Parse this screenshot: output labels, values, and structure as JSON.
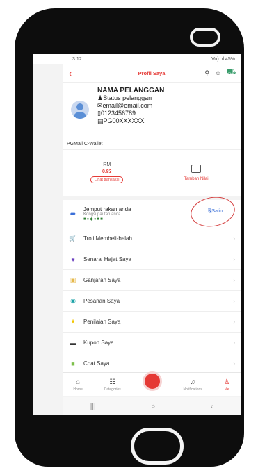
{
  "status": {
    "time": "3:12",
    "signal": "Vo) .ıl 45%"
  },
  "appbar": {
    "title": "Profil Saya"
  },
  "profile": {
    "name": "NAMA PELANGGAN",
    "status": "Status pelanggan",
    "email": "email@email.com",
    "phone": "0123456789",
    "id": "PG00XXXXXX"
  },
  "wallet": {
    "title": "PGMall C-Wallet",
    "currency": "RM",
    "amount": "0.83",
    "history_label": "Lihat transaksi",
    "topup_label": "Tambah Nilai"
  },
  "invite": {
    "title": "Jemput rakan anda",
    "subtitle": "Kongsi pautan anda",
    "copy_label": "Salin"
  },
  "menu": [
    {
      "label": "Troli Membeli-belah",
      "icon": "cart-icon",
      "color": "#e53935"
    },
    {
      "label": "Senarai Hajat Saya",
      "icon": "heart-icon",
      "color": "#6a3fbf"
    },
    {
      "label": "Ganjaran Saya",
      "icon": "gift-icon",
      "color": "#e6b84a"
    },
    {
      "label": "Pesanan Saya",
      "icon": "order-icon",
      "color": "#1aa1a6"
    },
    {
      "label": "Penilaian Saya",
      "icon": "star-icon",
      "color": "#f2c500"
    },
    {
      "label": "Kupon Saya",
      "icon": "coupon-icon",
      "color": "#333333"
    },
    {
      "label": "Chat Saya",
      "icon": "chat-icon",
      "color": "#7cbf4a"
    }
  ],
  "tabs": [
    {
      "label": "Home"
    },
    {
      "label": "Categories"
    },
    {
      "label": ""
    },
    {
      "label": "Notifications"
    },
    {
      "label": "Me"
    }
  ]
}
